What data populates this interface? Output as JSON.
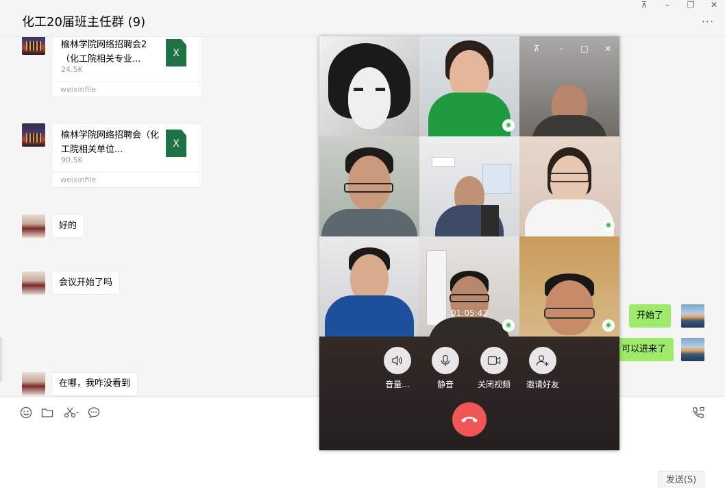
{
  "header": {
    "title": "化工20届班主任群 (9)",
    "more": "···"
  },
  "window_controls": {
    "pin": "⊼",
    "minimize": "–",
    "restore": "❐",
    "close": "✕"
  },
  "messages": {
    "file1": {
      "name": "榆林学院网络招聘会2（化工院相关专业...",
      "size": "24.5K",
      "source": "weixinfile",
      "ext": "X"
    },
    "file2": {
      "name": "榆林学院网络招聘会（化工院相关单位...",
      "size": "90.5K",
      "source": "weixinfile",
      "ext": "X"
    },
    "msg1": "好的",
    "msg2": "会议开始了吗",
    "msg3": "在哪，我咋没看到",
    "me1": "开始了",
    "me2": "可以进来了"
  },
  "input": {
    "send_label": "发送(S)",
    "tools": [
      "emoji-icon",
      "folder-icon",
      "scissors-icon",
      "chat-history-icon",
      "call-icon"
    ]
  },
  "call": {
    "controls": {
      "pin": "⊼",
      "minimize": "–",
      "maximize": "□",
      "close": "✕"
    },
    "timer": "01:05:42",
    "buttons": {
      "volume": "音量...",
      "mute": "静音",
      "camera": "关闭视频",
      "invite": "邀请好友"
    },
    "hangup_icon": "hang-up-icon"
  },
  "colors": {
    "self_bubble": "#9eea6a",
    "hangup": "#f05656",
    "excel": "#1f7244"
  }
}
